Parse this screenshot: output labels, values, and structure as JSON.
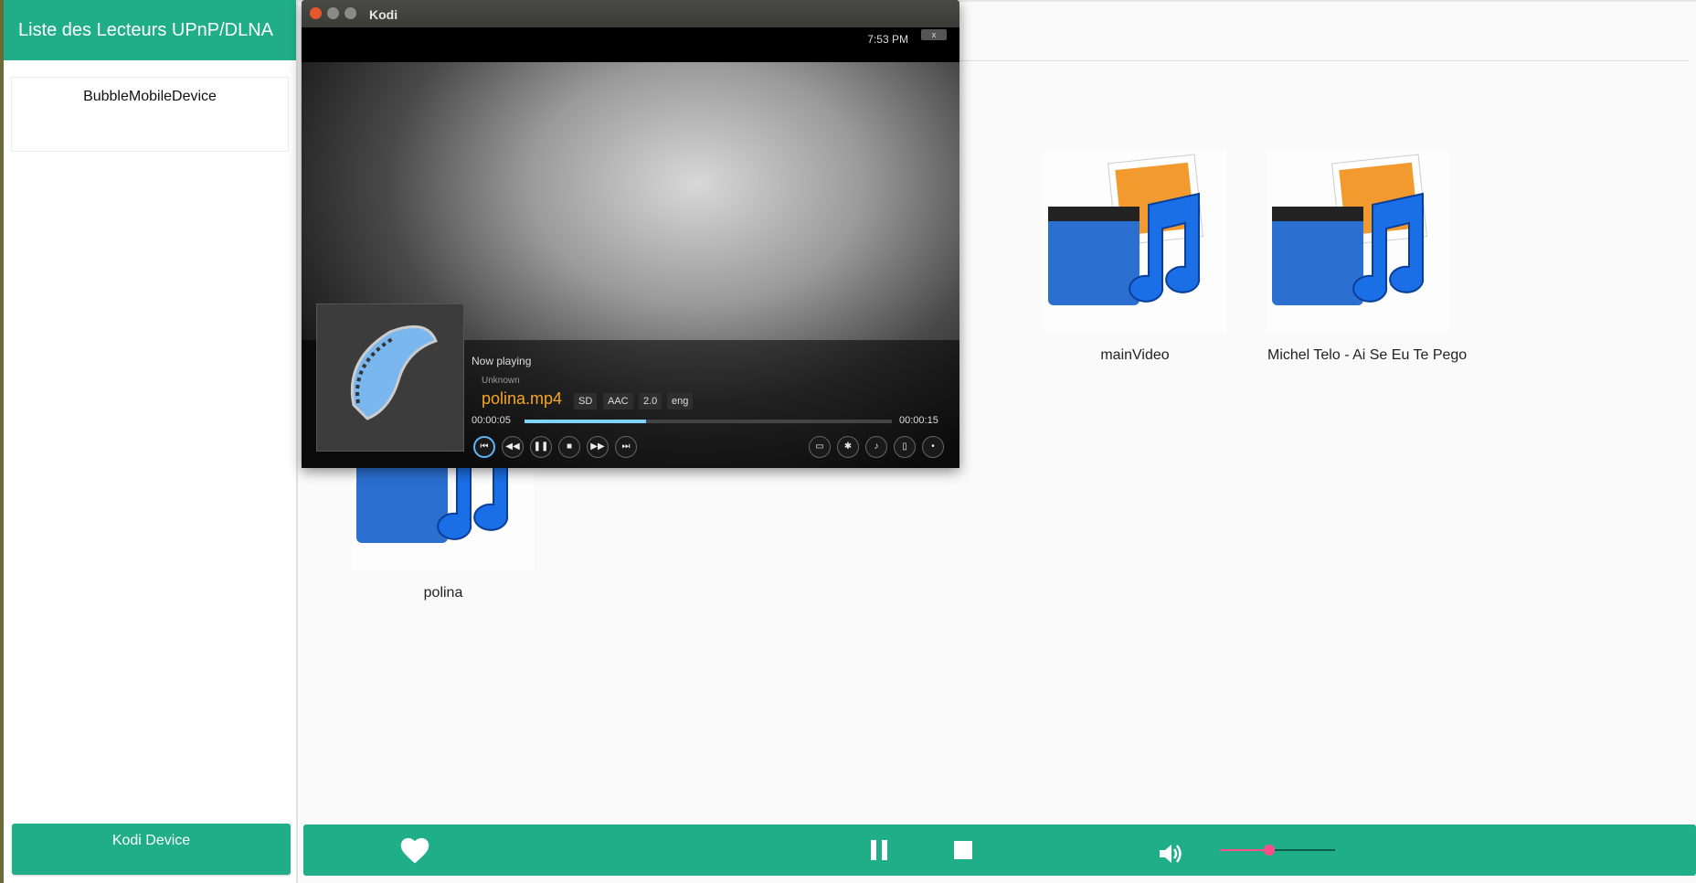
{
  "sidebar": {
    "title": "Liste des Lecteurs UPnP/DLNA",
    "devices": [
      "BubbleMobileDevice"
    ],
    "selected_device_label": "Kodi Device"
  },
  "media": {
    "items": [
      {
        "label": "mainVideo"
      },
      {
        "label": "Michel Telo - Ai Se Eu Te Pego"
      },
      {
        "label": "polina"
      }
    ]
  },
  "player": {
    "heart_icon": "heart-icon",
    "pause_icon": "pause-icon",
    "stop_icon": "stop-icon",
    "volume_icon": "volume-icon",
    "volume_level_percent": 43,
    "accent": "#1fae88",
    "slider_color": "#ff4f8b"
  },
  "kodi": {
    "window_title": "Kodi",
    "clock": "7:53 PM",
    "close_x": "x",
    "now_playing_label": "Now playing",
    "artist": "Unknown",
    "filename": "polina.mp4",
    "badges": [
      "SD",
      "AAC",
      "2.0",
      "eng"
    ],
    "time_elapsed": "00:00:05",
    "time_total": "00:00:15",
    "progress_percent": 33
  }
}
